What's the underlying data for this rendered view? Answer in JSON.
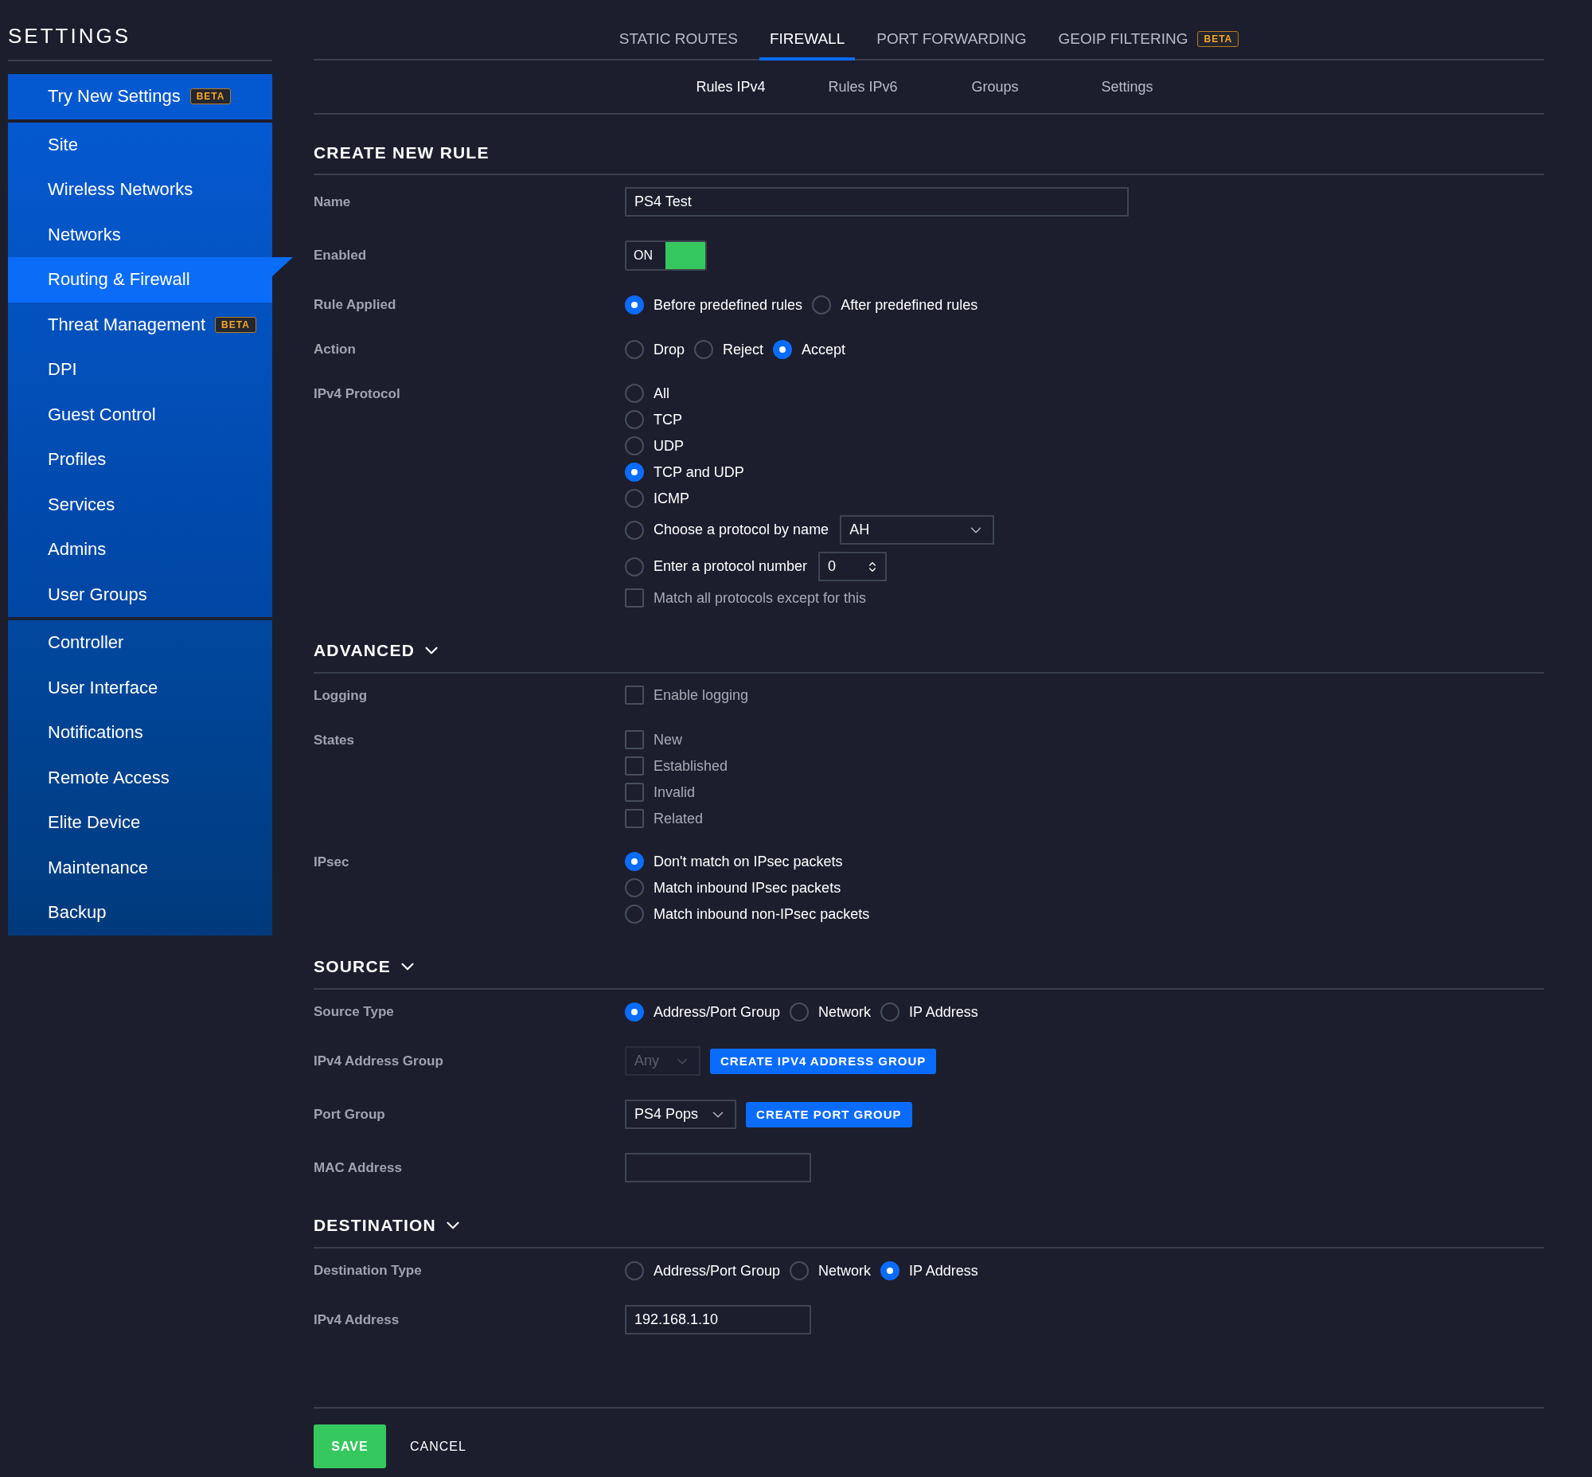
{
  "sidebar": {
    "title": "SETTINGS",
    "groups": [
      [
        {
          "label": "Try New Settings",
          "badge": "BETA",
          "selected": false
        }
      ],
      [
        {
          "label": "Site",
          "selected": false
        },
        {
          "label": "Wireless Networks",
          "selected": false
        },
        {
          "label": "Networks",
          "selected": false
        },
        {
          "label": "Routing & Firewall",
          "selected": true
        },
        {
          "label": "Threat Management",
          "badge": "BETA",
          "selected": false
        },
        {
          "label": "DPI",
          "selected": false
        },
        {
          "label": "Guest Control",
          "selected": false
        },
        {
          "label": "Profiles",
          "selected": false
        },
        {
          "label": "Services",
          "selected": false
        },
        {
          "label": "Admins",
          "selected": false
        },
        {
          "label": "User Groups",
          "selected": false
        }
      ],
      [
        {
          "label": "Controller",
          "selected": false
        },
        {
          "label": "User Interface",
          "selected": false
        },
        {
          "label": "Notifications",
          "selected": false
        },
        {
          "label": "Remote Access",
          "selected": false
        },
        {
          "label": "Elite Device",
          "selected": false
        },
        {
          "label": "Maintenance",
          "selected": false
        },
        {
          "label": "Backup",
          "selected": false
        }
      ]
    ]
  },
  "top_tabs": [
    {
      "label": "STATIC ROUTES",
      "selected": false
    },
    {
      "label": "FIREWALL",
      "selected": true
    },
    {
      "label": "PORT FORWARDING",
      "selected": false
    },
    {
      "label": "GEOIP FILTERING",
      "badge": "BETA",
      "selected": false
    }
  ],
  "sub_tabs": [
    {
      "label": "Rules IPv4",
      "selected": true
    },
    {
      "label": "Rules IPv6",
      "selected": false
    },
    {
      "label": "Groups",
      "selected": false
    },
    {
      "label": "Settings",
      "selected": false
    }
  ],
  "sections": [
    {
      "title": "CREATE NEW RULE",
      "rows": [
        {
          "label": "Name",
          "kind": "text",
          "value": "PS4 Test",
          "wide": true
        },
        {
          "label": "Enabled",
          "kind": "toggle",
          "on": true,
          "text": "ON"
        },
        {
          "label": "Rule Applied",
          "kind": "radio_inline",
          "options": [
            {
              "label": "Before predefined rules",
              "selected": true
            },
            {
              "label": "After predefined rules",
              "selected": false
            }
          ]
        },
        {
          "label": "Action",
          "kind": "radio_inline",
          "options": [
            {
              "label": "Drop",
              "selected": false
            },
            {
              "label": "Reject",
              "selected": false
            },
            {
              "label": "Accept",
              "selected": true
            }
          ]
        },
        {
          "label": "IPv4 Protocol",
          "kind": "option_list",
          "options": [
            {
              "kind": "radio",
              "label": "All",
              "selected": false
            },
            {
              "kind": "radio",
              "label": "TCP",
              "selected": false
            },
            {
              "kind": "radio",
              "label": "UDP",
              "selected": false
            },
            {
              "kind": "radio",
              "label": "TCP and UDP",
              "selected": true
            },
            {
              "kind": "radio",
              "label": "ICMP",
              "selected": false
            },
            {
              "kind": "radio_select",
              "label": "Choose a protocol by name",
              "selected": false,
              "value": "AH"
            },
            {
              "kind": "radio_number",
              "label": "Enter a protocol number",
              "selected": false,
              "value": "0"
            },
            {
              "kind": "checkbox",
              "label": "Match all protocols except for this",
              "checked": false
            }
          ]
        }
      ]
    },
    {
      "title": "ADVANCED",
      "expanded": true,
      "rows": [
        {
          "label": "Logging",
          "kind": "option_list",
          "options": [
            {
              "kind": "checkbox",
              "label": "Enable logging",
              "checked": false
            }
          ]
        },
        {
          "label": "States",
          "kind": "option_list",
          "options": [
            {
              "kind": "checkbox",
              "label": "New",
              "checked": false
            },
            {
              "kind": "checkbox",
              "label": "Established",
              "checked": false
            },
            {
              "kind": "checkbox",
              "label": "Invalid",
              "checked": false
            },
            {
              "kind": "checkbox",
              "label": "Related",
              "checked": false
            }
          ]
        },
        {
          "label": "IPsec",
          "kind": "option_list",
          "options": [
            {
              "kind": "radio",
              "label": "Don't match on IPsec packets",
              "selected": true
            },
            {
              "kind": "radio",
              "label": "Match inbound IPsec packets",
              "selected": false
            },
            {
              "kind": "radio",
              "label": "Match inbound non-IPsec packets",
              "selected": false
            }
          ]
        }
      ]
    },
    {
      "title": "SOURCE",
      "expanded": true,
      "rows": [
        {
          "label": "Source Type",
          "kind": "radio_inline",
          "options": [
            {
              "label": "Address/Port Group",
              "selected": true
            },
            {
              "label": "Network",
              "selected": false
            },
            {
              "label": "IP Address",
              "selected": false
            }
          ]
        },
        {
          "label": "IPv4 Address Group",
          "kind": "select_button",
          "value": "Any",
          "disabled": true,
          "button": "CREATE IPV4 ADDRESS GROUP"
        },
        {
          "label": "Port Group",
          "kind": "select_button",
          "value": "PS4 Pops",
          "disabled": false,
          "button": "CREATE PORT GROUP"
        },
        {
          "label": "MAC Address",
          "kind": "text",
          "wide": false
        }
      ]
    },
    {
      "title": "DESTINATION",
      "expanded": true,
      "rows": [
        {
          "label": "Destination Type",
          "kind": "radio_inline",
          "options": [
            {
              "label": "Address/Port Group",
              "selected": false
            },
            {
              "label": "Network",
              "selected": false
            },
            {
              "label": "IP Address",
              "selected": true
            }
          ]
        },
        {
          "label": "IPv4 Address",
          "kind": "text",
          "value": "192.168.1.10",
          "wide": false
        }
      ]
    }
  ],
  "actions": {
    "save": "SAVE",
    "cancel": "CANCEL"
  }
}
